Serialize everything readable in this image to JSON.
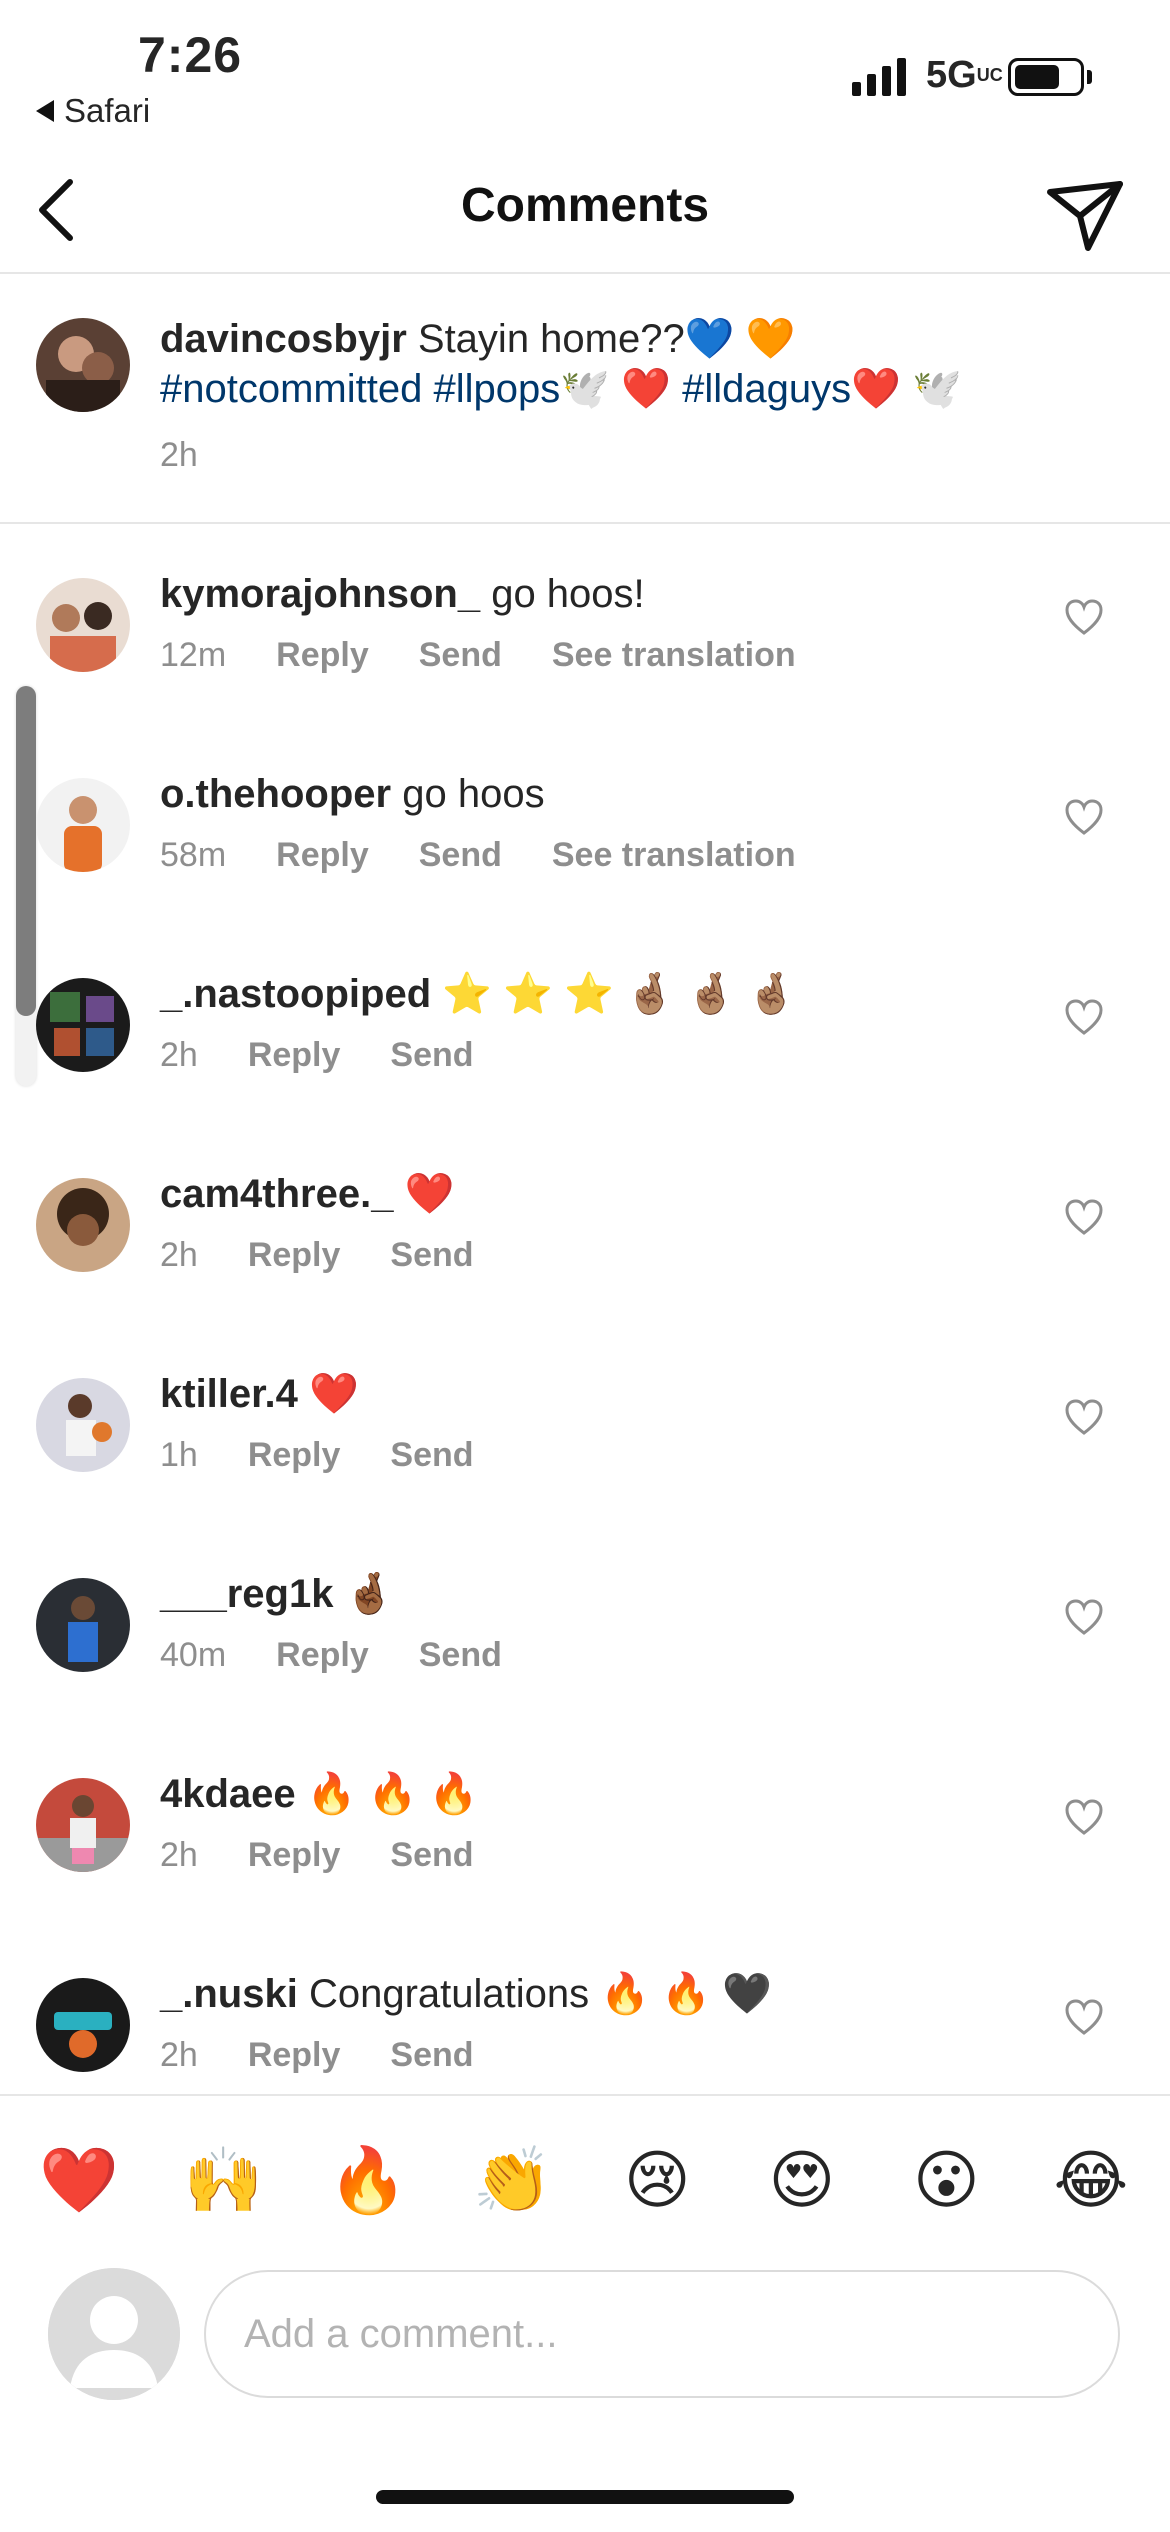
{
  "status_bar": {
    "time": "7:26",
    "back_app": "Safari",
    "network": "5G",
    "network_sub": "UC"
  },
  "header": {
    "title": "Comments"
  },
  "caption": {
    "username": "davincosbyjr",
    "text": "Stayin home??",
    "emojis_1": "💙 🧡",
    "hashtag_1": "#notcommitted",
    "hashtag_2": "#llpops",
    "emojis_2": "🕊️ ❤️",
    "hashtag_3": "#lldaguys",
    "emojis_3": "❤️ 🕊️",
    "time": "2h"
  },
  "comments": [
    {
      "username": "kymorajohnson_",
      "text": "go hoos!",
      "time": "12m",
      "reply": "Reply",
      "send": "Send",
      "translate": "See translation"
    },
    {
      "username": "o.thehooper",
      "text": "go hoos",
      "time": "58m",
      "reply": "Reply",
      "send": "Send",
      "translate": "See translation"
    },
    {
      "username": "_.nastoopiped",
      "text": "⭐ ⭐ ⭐ 🤞🏽 🤞🏽 🤞🏽",
      "time": "2h",
      "reply": "Reply",
      "send": "Send"
    },
    {
      "username": "cam4three._",
      "text": "❤️",
      "time": "2h",
      "reply": "Reply",
      "send": "Send"
    },
    {
      "username": "ktiller.4",
      "text": "❤️",
      "time": "1h",
      "reply": "Reply",
      "send": "Send"
    },
    {
      "username": "___reg1k",
      "text": "🤞🏾",
      "time": "40m",
      "reply": "Reply",
      "send": "Send"
    },
    {
      "username": "4kdaee",
      "text": "🔥 🔥 🔥",
      "time": "2h",
      "reply": "Reply",
      "send": "Send"
    },
    {
      "username": "_.nuski",
      "text": "Congratulations 🔥 🔥 🖤",
      "time": "2h",
      "reply": "Reply",
      "send": "Send"
    }
  ],
  "emoji_bar": [
    "❤️",
    "🙌",
    "🔥",
    "👏",
    "😢",
    "😍",
    "😮",
    "😂"
  ],
  "input": {
    "placeholder": "Add a comment..."
  },
  "colors": {
    "text": "#262626",
    "secondary": "#8e8e8e",
    "hashtag": "#00376b",
    "divider": "#e6e6e6"
  },
  "icons": {
    "back": "chevron-left-icon",
    "send": "paper-plane-icon",
    "like": "heart-outline-icon"
  }
}
